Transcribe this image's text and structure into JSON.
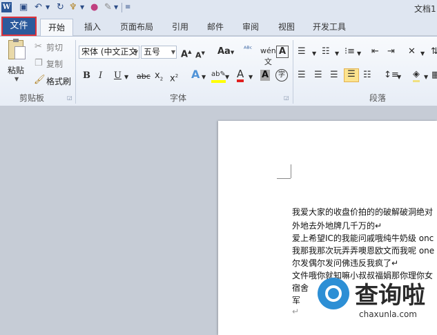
{
  "qat": {
    "word_icon": "W",
    "title": "文档1"
  },
  "tabs": [
    "文件",
    "开始",
    "插入",
    "页面布局",
    "引用",
    "邮件",
    "审阅",
    "视图",
    "开发工具"
  ],
  "clipboard": {
    "paste": "粘贴",
    "cut": "剪切",
    "copy": "复制",
    "format_painter": "格式刷",
    "group": "剪贴板"
  },
  "font": {
    "name": "宋体 (中文正文",
    "size": "五号",
    "group": "字体"
  },
  "paragraph": {
    "group": "段落"
  },
  "document": {
    "lines": [
      "我爱大家的收盘价拍的的破解破洞绝对",
      "外地去外地牌几千万的↵",
      "爱上希望IC的我能问戚哦纯牛奶级 onc",
      "我那我那次玩弄弄噢恩欧文而我呢 one",
      "尔发偶尔发问佛违反我疯了↵",
      "文件哦你就知嘛小叔叔福娟那你理你女",
      "宿舍",
      "军",
      "↵"
    ]
  },
  "watermark": {
    "text": "查询啦",
    "url": "chaxunla.com"
  },
  "colors": {
    "file_tab": "#2c5a9c",
    "highlight_border": "#e0323a",
    "watermark_blue": "#2d8fd5"
  }
}
